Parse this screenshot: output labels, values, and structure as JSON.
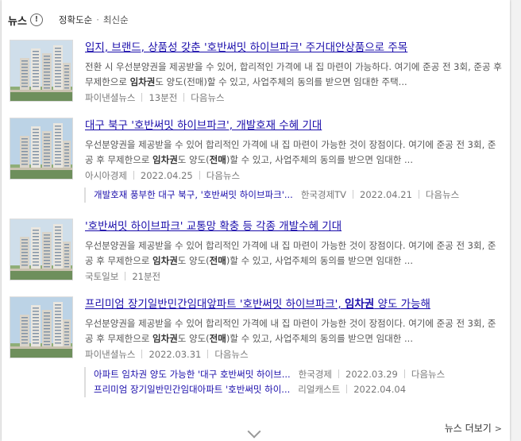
{
  "header": {
    "title": "뉴스",
    "info_icon": "!",
    "sort_options": [
      "정확도순",
      "최신순"
    ],
    "sort_selected": "정확도순"
  },
  "items": [
    {
      "title_parts": [
        {
          "t": "입지, 브랜드, 상품성 갖춘 '호반써밋 하이브파크' 주거대안상품으로 주목",
          "b": false
        }
      ],
      "snippet": [
        {
          "t": "전환 시 우선분양권을 제공받을 수 있어, 합리적인 가격에 내 집 마련이 가능하다. 여기에 준공 전 3회, 준공 후 무제한으로 ",
          "b": false
        },
        {
          "t": "임차권",
          "b": true
        },
        {
          "t": "도 양도(전매)할 수 있고, 사업주체의 동의를 받으면 임대한 주택...",
          "b": false
        }
      ],
      "source": "파이낸셜뉴스",
      "date": "13분전",
      "portal": "다음뉴스"
    },
    {
      "title_parts": [
        {
          "t": "대구 북구 '호반써밋 하이브파크', 개발호재 수혜 기대",
          "b": false
        }
      ],
      "snippet": [
        {
          "t": "우선분양권을 제공받을 수 있어 합리적인 가격에 내 집 마련이 가능한 것이 장점이다. 여기에 준공 전 3회, 준공 후 무제한으로 ",
          "b": false
        },
        {
          "t": "임차권",
          "b": true
        },
        {
          "t": "도 양도(",
          "b": false
        },
        {
          "t": "전매",
          "b": true
        },
        {
          "t": ")할 수 있고, 사업주체의 동의를 받으면 임대한 ...",
          "b": false
        }
      ],
      "source": "아시아경제",
      "date": "2022.04.25",
      "portal": "다음뉴스",
      "related": [
        {
          "title": "개발호재 풍부한 대구 북구, '호반써밋 하이브파크'...",
          "source": "한국경제TV",
          "date": "2022.04.21",
          "portal": "다음뉴스"
        }
      ]
    },
    {
      "title_parts": [
        {
          "t": "'호반써밋 하이브파크' 교통망 확충 등 각종 개발수혜 기대",
          "b": false
        }
      ],
      "snippet": [
        {
          "t": "우선분양권을 제공받을 수 있어 합리적인 가격에 내 집 마련이 가능한 것이 장점이다. 여기에 준공 전 3회, 준공 후 무제한으로 ",
          "b": false
        },
        {
          "t": "임차권",
          "b": true
        },
        {
          "t": "도 양도(",
          "b": false
        },
        {
          "t": "전매",
          "b": true
        },
        {
          "t": ")할 수 있고, 사업주체의 동의를 받으면 임대한 ...",
          "b": false
        }
      ],
      "source": "국토일보",
      "date": "21분전",
      "portal": ""
    },
    {
      "title_parts": [
        {
          "t": "프리미엄 장기일반민간임대앞파트 '호반써밋 하이브파크', ",
          "b": false
        },
        {
          "t": "임차권",
          "b": true
        },
        {
          "t": " 양도 가능해",
          "b": false
        }
      ],
      "snippet": [
        {
          "t": "우선분양권을 제공받을 수 있어 합리적인 가격에 내 집 마련이 가능한 것이 장점이다. 여기에 준공 전 3회, 준공 후 무제한으로 ",
          "b": false
        },
        {
          "t": "임차권",
          "b": true
        },
        {
          "t": "도 양도(",
          "b": false
        },
        {
          "t": "전매",
          "b": true
        },
        {
          "t": ")할 수 있고, 사업주체의 동의를 받으면 임대한 ...",
          "b": false
        }
      ],
      "source": "파이낸셜뉴스",
      "date": "2022.03.31",
      "portal": "다음뉴스",
      "related": [
        {
          "title": "아파트 임차권 양도 가능한 '대구 호반써밋 하이브...",
          "source": "한국경제",
          "date": "2022.03.29",
          "portal": "다음뉴스"
        },
        {
          "title": "프리미엄 장기일반민간임대아파트 '호반써밋 하이...",
          "source": "리얼캐스트",
          "date": "2022.04.04",
          "portal": ""
        }
      ]
    }
  ],
  "footer": {
    "more_label": "뉴스 더보기",
    "more_arrow": ">"
  },
  "icons": [
    "info-icon",
    "chevron-down-icon",
    "chevron-right-icon"
  ],
  "colors": {
    "link": "#1a0dab",
    "text": "#555555",
    "meta": "#777777"
  }
}
